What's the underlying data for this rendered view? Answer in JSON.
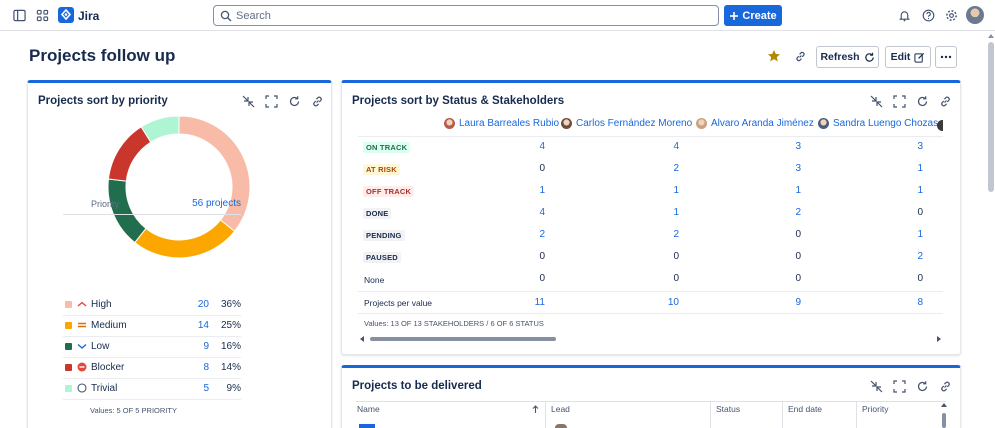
{
  "topbar": {
    "app_name": "Jira",
    "search_placeholder": "Search",
    "create_label": "Create"
  },
  "page": {
    "title": "Projects follow up",
    "refresh_label": "Refresh",
    "edit_label": "Edit"
  },
  "priority_card": {
    "title": "Projects sort by priority",
    "legend_header": "Priority",
    "total_link": "56 projects",
    "values_note": "Values: 5 OF 5 PRIORITY",
    "items": [
      {
        "label": "High",
        "count": "20",
        "pct": "36%",
        "color": "#f8bba7",
        "icon": "chevron-up-icon"
      },
      {
        "label": "Medium",
        "count": "14",
        "pct": "25%",
        "color": "#fca700",
        "icon": "equals-icon"
      },
      {
        "label": "Low",
        "count": "9",
        "pct": "16%",
        "color": "#216e4e",
        "icon": "chevron-down-icon"
      },
      {
        "label": "Blocker",
        "count": "8",
        "pct": "14%",
        "color": "#c9372c",
        "icon": "blocker-icon"
      },
      {
        "label": "Trivial",
        "count": "5",
        "pct": "9%",
        "color": "#aef5d4",
        "icon": "circle-outline-icon"
      }
    ]
  },
  "chart_data": {
    "type": "pie",
    "categories": [
      "High",
      "Medium",
      "Low",
      "Blocker",
      "Trivial"
    ],
    "values": [
      20,
      14,
      9,
      8,
      5
    ],
    "colors": [
      "#f8bba7",
      "#fca700",
      "#216e4e",
      "#c9372c",
      "#aef5d4"
    ],
    "donut": true,
    "title": "",
    "legend_placement": "bottom"
  },
  "status_card": {
    "title": "Projects sort by Status & Stakeholders",
    "stakeholders": [
      "Laura Barreales Rubio",
      "Carlos Fernández Moreno",
      "Alvaro Aranda Jiménez",
      "Sandra Luengo Chozas"
    ],
    "rows": [
      {
        "label": "ON TRACK",
        "kind": "green",
        "values": [
          "4",
          "4",
          "3",
          "3"
        ]
      },
      {
        "label": "AT RISK",
        "kind": "yellow",
        "values": [
          "0",
          "2",
          "3",
          "1"
        ]
      },
      {
        "label": "OFF TRACK",
        "kind": "red",
        "values": [
          "1",
          "1",
          "1",
          "1"
        ]
      },
      {
        "label": "DONE",
        "kind": "gray",
        "values": [
          "4",
          "1",
          "2",
          "0"
        ]
      },
      {
        "label": "PENDING",
        "kind": "gray",
        "values": [
          "2",
          "2",
          "0",
          "1"
        ]
      },
      {
        "label": "PAUSED",
        "kind": "gray",
        "values": [
          "0",
          "0",
          "0",
          "2"
        ]
      },
      {
        "label": "None",
        "kind": "plain",
        "values": [
          "0",
          "0",
          "0",
          "0"
        ]
      }
    ],
    "totals_label": "Projects per value",
    "totals": [
      "11",
      "10",
      "9",
      "8"
    ],
    "values_note": "Values: 13 OF 13 STAKEHOLDERS / 6 OF 6 STATUS"
  },
  "delivery_card": {
    "title": "Projects to be delivered",
    "columns": [
      "Name",
      "Lead",
      "Status",
      "End date",
      "Priority"
    ]
  }
}
